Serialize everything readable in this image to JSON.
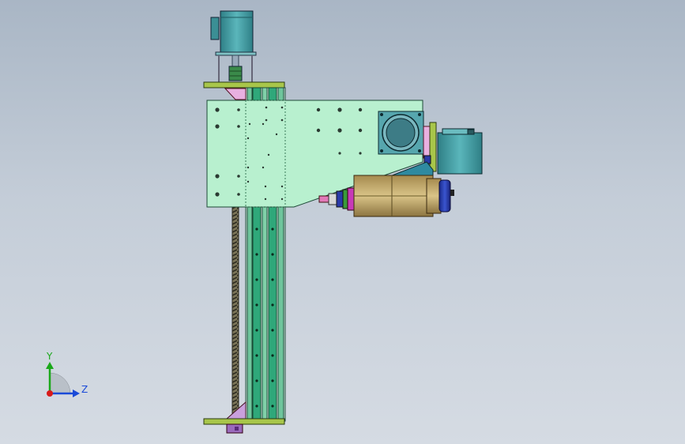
{
  "viewport": {
    "background_top": "#a9b6c5",
    "background_bottom": "#d5dbe3"
  },
  "model": {
    "parts": [
      "stepper-motor-top",
      "motor-coupling",
      "top-mount-plate",
      "carriage-plate",
      "linear-rail-column",
      "ball-screw",
      "gearbox",
      "servo-motor-side",
      "spindle-motor",
      "bottom-mount-plate"
    ],
    "colors": {
      "plate": "#b8f0cf",
      "rail": "#2fa87a",
      "motor": "#4aa3a8",
      "spindle": "#c8ae72",
      "mount": "#a8c64a",
      "bracket": "#c9a0dc",
      "screw": "#4a4a3a",
      "blue_cap": "#2a3aa8"
    }
  },
  "triad": {
    "y_label": "Y",
    "z_label": "Z",
    "y_color": "#1aa81a",
    "z_color": "#1a4ad8",
    "x_color": "#d81a1a"
  }
}
